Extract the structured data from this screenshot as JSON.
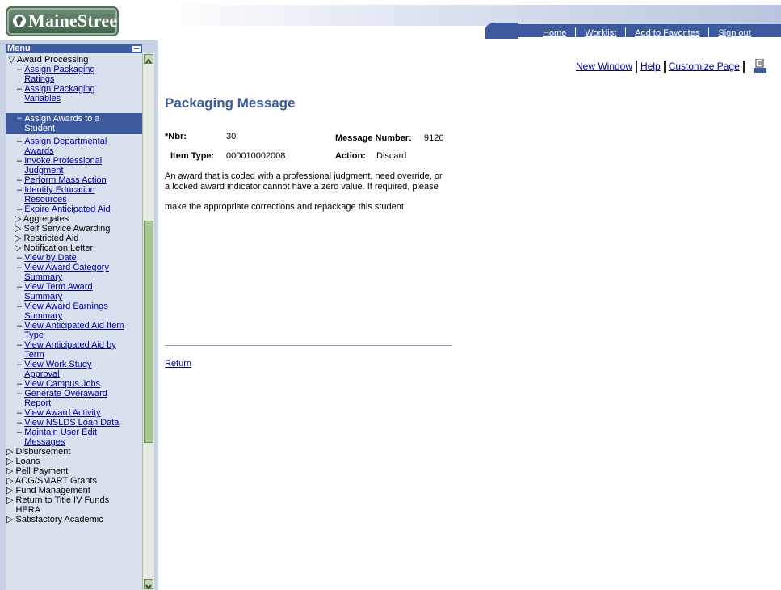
{
  "brand": {
    "name": "MaineStreet"
  },
  "header": {
    "nav": [
      "Home",
      "Worklist",
      "Add to Favorites",
      "Sign out"
    ]
  },
  "sidebar": {
    "title": "Menu",
    "items": [
      {
        "label": "Award Processing",
        "type": "expanded-folder"
      },
      {
        "label": "Assign Packaging Ratings",
        "type": "link"
      },
      {
        "label": "Assign Packaging Variables",
        "type": "link"
      },
      {
        "label": "Assign Awards to a Student",
        "type": "selected"
      },
      {
        "label": "Assign Departmental Awards",
        "type": "link"
      },
      {
        "label": "Invoke Professional Judgment",
        "type": "link"
      },
      {
        "label": "Perform Mass Action",
        "type": "link"
      },
      {
        "label": "Identify Education Resources",
        "type": "link"
      },
      {
        "label": "Expire Anticipated Aid",
        "type": "link"
      },
      {
        "label": "Aggregates",
        "type": "folder"
      },
      {
        "label": "Self Service Awarding",
        "type": "folder"
      },
      {
        "label": "Restricted Aid",
        "type": "folder"
      },
      {
        "label": "Notification Letter",
        "type": "folder"
      },
      {
        "label": "View by Date",
        "type": "link"
      },
      {
        "label": "View Award Category Summary",
        "type": "link"
      },
      {
        "label": "View Term Award Summary",
        "type": "link"
      },
      {
        "label": "View Award Earnings Summary",
        "type": "link"
      },
      {
        "label": "View Anticipated Aid Item Type",
        "type": "link"
      },
      {
        "label": "View Anticipated Aid by Term",
        "type": "link"
      },
      {
        "label": "View Work Study Approval",
        "type": "link"
      },
      {
        "label": "View Campus Jobs",
        "type": "link"
      },
      {
        "label": "Generate Overaward Report",
        "type": "link"
      },
      {
        "label": "View Award Activity",
        "type": "link"
      },
      {
        "label": "View NSLDS Loan Data",
        "type": "link"
      },
      {
        "label": "Maintain User Edit Messages",
        "type": "link"
      },
      {
        "label": "Disbursement",
        "type": "folder"
      },
      {
        "label": "Loans",
        "type": "folder"
      },
      {
        "label": "Pell Payment",
        "type": "folder"
      },
      {
        "label": "ACG/SMART Grants",
        "type": "folder"
      },
      {
        "label": "Fund Management",
        "type": "folder"
      },
      {
        "label": "Return to Title IV Funds HERA",
        "type": "folder"
      },
      {
        "label": "Satisfactory Academic",
        "type": "folder"
      }
    ]
  },
  "page_links": [
    "New Window",
    "Help",
    "Customize Page"
  ],
  "main": {
    "title": "Packaging Message",
    "nbr_label": "*Nbr:",
    "nbr_value": "30",
    "msgnum_label": "Message Number:",
    "msgnum_value": "9126",
    "itemtype_label": "Item Type:",
    "itemtype_value": "000010002008",
    "action_label": "Action:",
    "action_value": "Discard",
    "message_line1": "An award that is coded with a professional judgment, need override, or",
    "message_line2": "a locked award indicator cannot have a zero value. If required, please",
    "message_line3": "make the appropriate corrections and repackage this student.",
    "return_label": "Return"
  },
  "colors": {
    "accent": "#3d5a9e",
    "sidebar": "#d9e1ef",
    "scrollbar": "#a7c491"
  }
}
